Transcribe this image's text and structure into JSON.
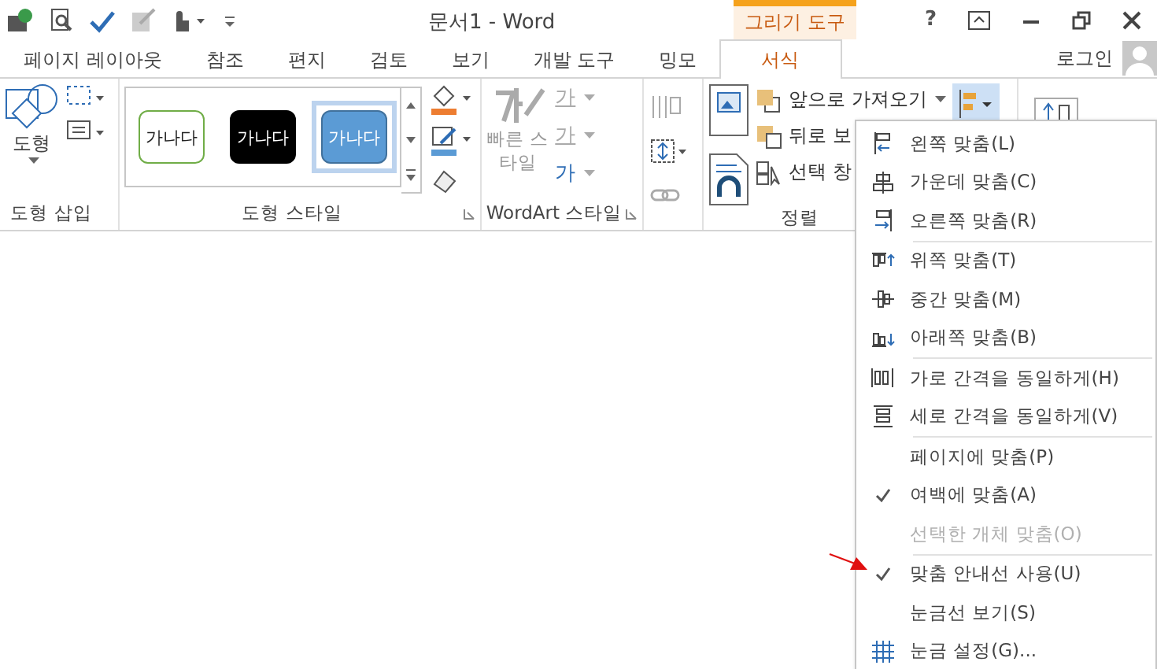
{
  "window": {
    "title": "문서1 - Word",
    "context_tab": "그리기 도구",
    "help": "?"
  },
  "tabs": [
    {
      "label": "페이지 레이아웃",
      "selected": false
    },
    {
      "label": "참조",
      "selected": false
    },
    {
      "label": "편지",
      "selected": false
    },
    {
      "label": "검토",
      "selected": false
    },
    {
      "label": "보기",
      "selected": false
    },
    {
      "label": "개발 도구",
      "selected": false
    },
    {
      "label": "밍모",
      "selected": false
    },
    {
      "label": "서식",
      "selected": true
    }
  ],
  "account": {
    "label": "로그인"
  },
  "ribbon": {
    "insert_shapes": {
      "button": "도형",
      "label": "도형 삽입"
    },
    "shape_styles": {
      "label": "도형 스타일",
      "styles": [
        {
          "text": "가나다",
          "kind": "outline",
          "selected": false
        },
        {
          "text": "가나다",
          "kind": "dark",
          "selected": false
        },
        {
          "text": "가나다",
          "kind": "filled",
          "selected": true
        }
      ]
    },
    "wordart": {
      "label": "WordArt 스타일",
      "quick_styles": "빠른 스\n타일",
      "letters": [
        "가",
        "가",
        "가"
      ]
    },
    "arrange": {
      "label": "정렬",
      "bring_forward": "앞으로 가져오기",
      "send_backward": "뒤로 보",
      "selection_pane": "선택 창"
    }
  },
  "align_menu": {
    "sections": [
      [
        {
          "label": "왼쪽 맞춤(L)",
          "kind": "align"
        },
        {
          "label": "가운데 맞춤(C)",
          "kind": "align"
        },
        {
          "label": "오른쪽 맞춤(R)",
          "kind": "align"
        }
      ],
      [
        {
          "label": "위쪽 맞춤(T)",
          "kind": "valign"
        },
        {
          "label": "중간 맞춤(M)",
          "kind": "valign"
        },
        {
          "label": "아래쪽 맞춤(B)",
          "kind": "valign"
        }
      ],
      [
        {
          "label": "가로 간격을 동일하게(H)",
          "kind": "distribute"
        },
        {
          "label": "세로 간격을 동일하게(V)",
          "kind": "distribute"
        }
      ],
      [
        {
          "label": "페이지에 맞춤(P)",
          "kind": "check",
          "checked": false,
          "disabled": false
        },
        {
          "label": "여백에 맞춤(A)",
          "kind": "check",
          "checked": true,
          "disabled": false
        },
        {
          "label": "선택한 개체 맞춤(O)",
          "kind": "check",
          "checked": false,
          "disabled": true
        }
      ],
      [
        {
          "label": "맞춤 안내선 사용(U)",
          "kind": "check",
          "checked": true,
          "disabled": false
        },
        {
          "label": "눈금선 보기(S)",
          "kind": "check",
          "checked": false,
          "disabled": false
        },
        {
          "label": "눈금 설정(G)...",
          "kind": "grid"
        }
      ]
    ]
  }
}
